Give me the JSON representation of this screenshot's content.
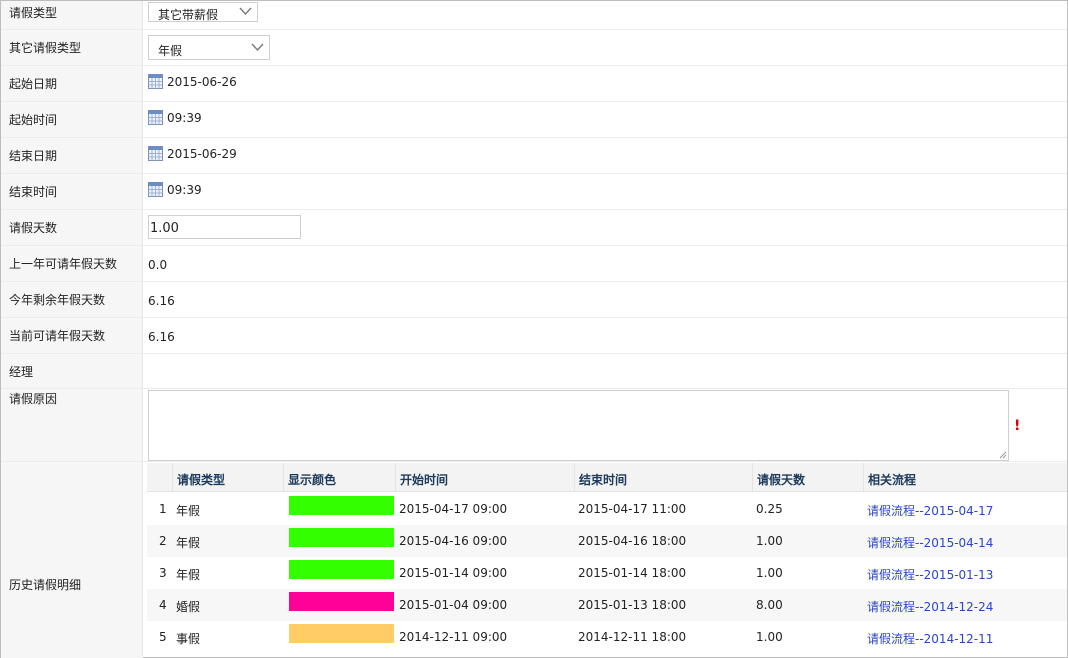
{
  "form": {
    "leave_type": {
      "label": "请假类型",
      "value": "其它带薪假"
    },
    "other_leave_type": {
      "label": "其它请假类型",
      "value": "年假"
    },
    "start_date": {
      "label": "起始日期",
      "value": "2015-06-26"
    },
    "start_time": {
      "label": "起始时间",
      "value": "09:39"
    },
    "end_date": {
      "label": "结束日期",
      "value": "2015-06-29"
    },
    "end_time": {
      "label": "结束时间",
      "value": "09:39"
    },
    "leave_days": {
      "label": "请假天数",
      "value": "1.00"
    },
    "last_year_days": {
      "label": "上一年可请年假天数",
      "value": "0.0"
    },
    "remaining_days": {
      "label": "今年剩余年假天数",
      "value": "6.16"
    },
    "current_days": {
      "label": "当前可请年假天数",
      "value": "6.16"
    },
    "manager": {
      "label": "经理",
      "value": ""
    },
    "reason": {
      "label": "请假原因",
      "value": "",
      "required_mark": "!"
    },
    "history": {
      "label": "历史请假明细"
    }
  },
  "history_table": {
    "headers": [
      "请假类型",
      "显示颜色",
      "开始时间",
      "结束时间",
      "请假天数",
      "相关流程"
    ],
    "rows": [
      {
        "index": "1",
        "type": "年假",
        "color": "#33ff00",
        "start": "2015-04-17 09:00",
        "end": "2015-04-17 11:00",
        "days": "0.25",
        "flow": "请假流程--2015-04-17"
      },
      {
        "index": "2",
        "type": "年假",
        "color": "#33ff00",
        "start": "2015-04-16 09:00",
        "end": "2015-04-16 18:00",
        "days": "1.00",
        "flow": "请假流程--2015-04-14"
      },
      {
        "index": "3",
        "type": "年假",
        "color": "#33ff00",
        "start": "2015-01-14 09:00",
        "end": "2015-01-14 18:00",
        "days": "1.00",
        "flow": "请假流程--2015-01-13"
      },
      {
        "index": "4",
        "type": "婚假",
        "color": "#ff0099",
        "start": "2015-01-04 09:00",
        "end": "2015-01-13 18:00",
        "days": "8.00",
        "flow": "请假流程--2014-12-24"
      },
      {
        "index": "5",
        "type": "事假",
        "color": "#ffcc66",
        "start": "2014-12-11 09:00",
        "end": "2014-12-11 18:00",
        "days": "1.00",
        "flow": "请假流程--2014-12-11"
      }
    ]
  },
  "icons": {
    "calendar": "calendar-icon",
    "dropdown": "chevron-down-icon"
  }
}
